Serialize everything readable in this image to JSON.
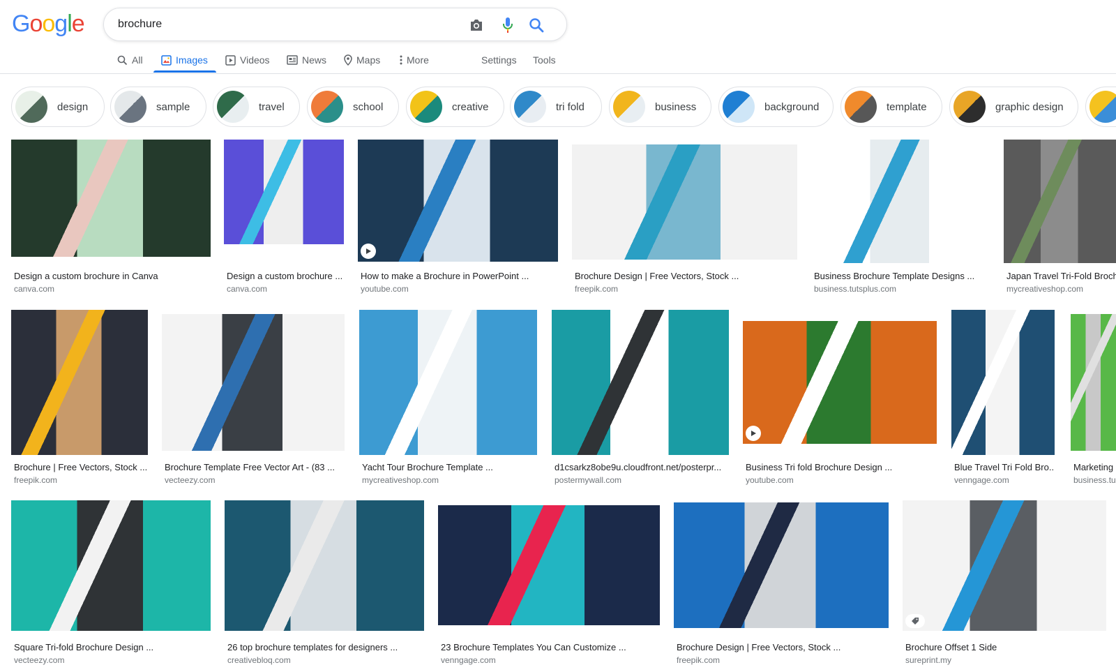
{
  "logo": {
    "letters": [
      "G",
      "o",
      "o",
      "g",
      "l",
      "e"
    ],
    "colors": [
      "#4285f4",
      "#ea4335",
      "#fbbc05",
      "#4285f4",
      "#34a853",
      "#ea4335"
    ]
  },
  "search": {
    "value": "brochure",
    "icons": [
      "camera-icon",
      "microphone-icon",
      "search-icon"
    ]
  },
  "nav": {
    "all": "All",
    "images": "Images",
    "videos": "Videos",
    "news": "News",
    "maps": "Maps",
    "more": "More",
    "settings": "Settings",
    "tools": "Tools"
  },
  "chips": [
    {
      "label": "design",
      "colors": [
        "#e8f0e8",
        "#506a5a"
      ]
    },
    {
      "label": "sample",
      "colors": [
        "#e4e8ea",
        "#6a7480"
      ]
    },
    {
      "label": "travel",
      "colors": [
        "#2f6b4a",
        "#e8eef0"
      ]
    },
    {
      "label": "school",
      "colors": [
        "#ef7b3a",
        "#2b8f8a"
      ]
    },
    {
      "label": "creative",
      "colors": [
        "#f2c318",
        "#1b8a7c"
      ]
    },
    {
      "label": "tri fold",
      "colors": [
        "#2f89c9",
        "#e8edf2"
      ]
    },
    {
      "label": "business",
      "colors": [
        "#f1b51c",
        "#e8eef2"
      ]
    },
    {
      "label": "background",
      "colors": [
        "#1f7fd3",
        "#cfe6f7"
      ]
    },
    {
      "label": "template",
      "colors": [
        "#f08a2c",
        "#575757"
      ]
    },
    {
      "label": "graphic design",
      "colors": [
        "#e8a526",
        "#2d2d2d"
      ]
    },
    {
      "label": "",
      "colors": [
        "#f4c21f",
        "#3b8ed8"
      ]
    }
  ],
  "results": [
    {
      "title": "Design a custom brochure in Canva",
      "source": "canva.com",
      "colors": [
        "#b8dcc0",
        "#243a2c",
        "#e9c7bf"
      ],
      "video": false
    },
    {
      "title": "Design a custom brochure ...",
      "source": "canva.com",
      "colors": [
        "#eeeeee",
        "#5a4fd8",
        "#3dbde5"
      ],
      "video": false
    },
    {
      "title": "How to make a Brochure in PowerPoint ...",
      "source": "youtube.com",
      "colors": [
        "#d9e3ec",
        "#1d3a55",
        "#2a7fc2"
      ],
      "video": true
    },
    {
      "title": "Brochure Design | Free Vectors, Stock ...",
      "source": "freepik.com",
      "colors": [
        "#79b7cf",
        "#f2f2f2",
        "#2a9fc4"
      ],
      "video": false
    },
    {
      "title": "Business Brochure Template Designs ...",
      "source": "business.tutsplus.com",
      "colors": [
        "#e6ecef",
        "#ffffff",
        "#2fa0d0"
      ],
      "video": false
    },
    {
      "title": "Japan Travel Tri-Fold Brochure",
      "source": "mycreativeshop.com",
      "colors": [
        "#8c8c8c",
        "#5a5a5a",
        "#6e8c5c"
      ],
      "video": false
    },
    {
      "title": "Brochure | Free Vectors, Stock ...",
      "source": "freepik.com",
      "colors": [
        "#c89a6a",
        "#2b2f3a",
        "#f2b31c"
      ],
      "video": false
    },
    {
      "title": "Brochure Template Free Vector Art - (83 ...",
      "source": "vecteezy.com",
      "colors": [
        "#3a3f45",
        "#f3f3f3",
        "#2e6fb0"
      ],
      "video": false
    },
    {
      "title": "Yacht Tour Brochure Template ...",
      "source": "mycreativeshop.com",
      "colors": [
        "#eef3f6",
        "#3d9bd2",
        "#ffffff"
      ],
      "video": false
    },
    {
      "title": "d1csarkz8obe9u.cloudfront.net/posterpr...",
      "source": "postermywall.com",
      "colors": [
        "#ffffff",
        "#1a9ca4",
        "#2f3336"
      ],
      "video": false
    },
    {
      "title": "Business Tri fold Brochure Design ...",
      "source": "youtube.com",
      "colors": [
        "#2c7a2f",
        "#d9691c",
        "#ffffff"
      ],
      "video": true
    },
    {
      "title": "Blue Travel Tri Fold Bro...",
      "source": "venngage.com",
      "colors": [
        "#f4f4f4",
        "#1f4f73",
        "#ffffff"
      ],
      "video": false
    },
    {
      "title": "Marketing ...",
      "source": "business.tu...",
      "colors": [
        "#c8c8c8",
        "#58b848",
        "#e0e0e0"
      ],
      "video": false
    },
    {
      "title": "Square Tri-fold Brochure Design ...",
      "source": "vecteezy.com",
      "colors": [
        "#2f3336",
        "#1db6a8",
        "#f2f2f2"
      ],
      "video": false
    },
    {
      "title": "26 top brochure templates for designers ...",
      "source": "creativebloq.com",
      "colors": [
        "#d6dde2",
        "#1c5870",
        "#eaeaea"
      ],
      "video": false
    },
    {
      "title": "23 Brochure Templates You Can Customize ...",
      "source": "venngage.com",
      "colors": [
        "#22b5c2",
        "#1b2a4a",
        "#e8244e"
      ],
      "video": false
    },
    {
      "title": "Brochure Design | Free Vectors, Stock ...",
      "source": "freepik.com",
      "colors": [
        "#d0d4d8",
        "#1d6fbf",
        "#1f2a44"
      ],
      "video": false
    },
    {
      "title": "Brochure Offset 1 Side",
      "source": "sureprint.my",
      "colors": [
        "#5a5e63",
        "#f3f3f3",
        "#2596d6"
      ],
      "video": false
    }
  ]
}
